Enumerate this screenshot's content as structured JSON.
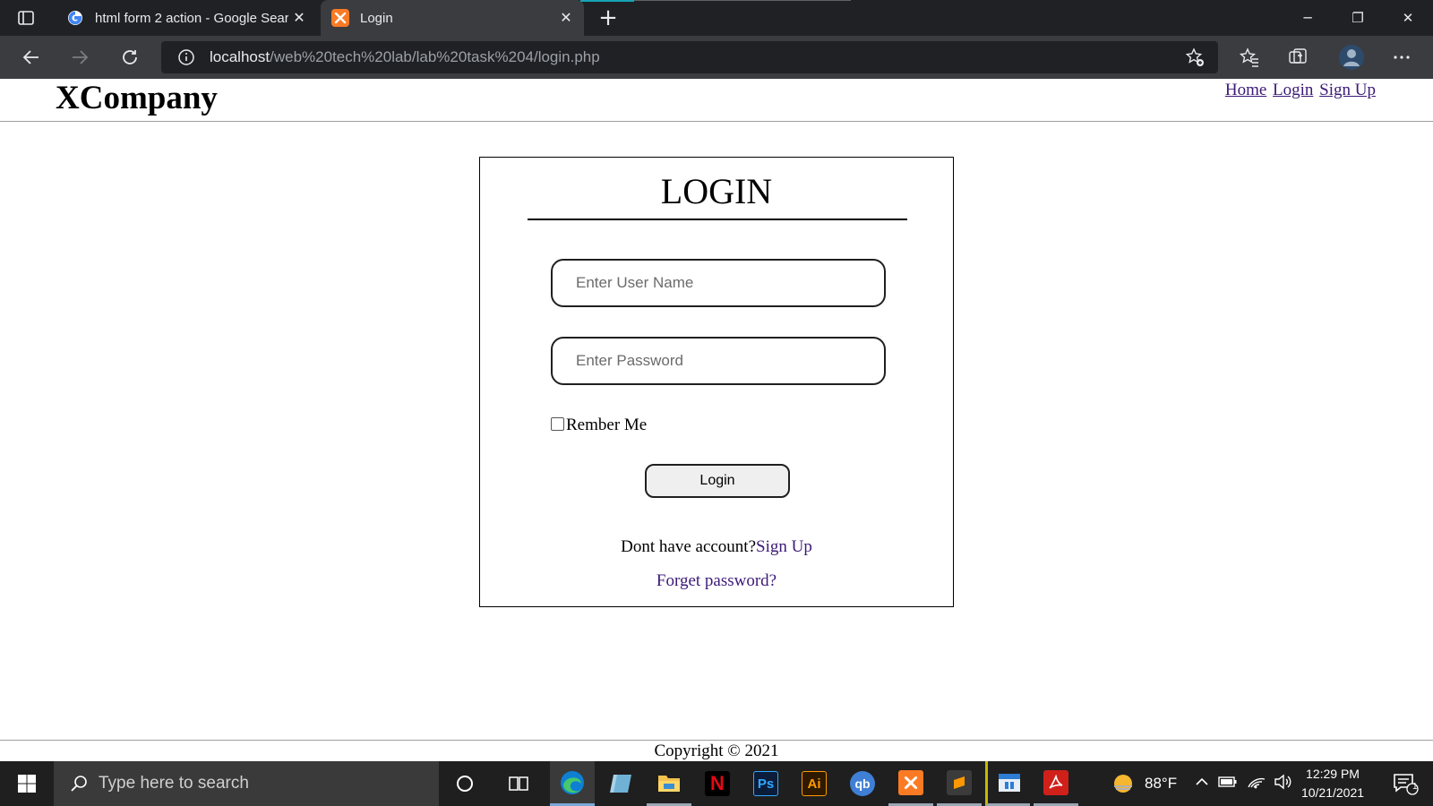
{
  "browser": {
    "tabs": [
      {
        "title": "html form 2 action - Google Sear",
        "favicon": "google-g-icon",
        "active": false
      },
      {
        "title": "Login",
        "favicon": "xampp-icon",
        "active": true
      }
    ],
    "new_tab_glyph": "+",
    "address": {
      "host": "localhost",
      "path": "/web%20tech%20lab/lab%20task%204/login.php"
    },
    "window_controls": {
      "minimize": "─",
      "restore": "❐",
      "close": "✕"
    }
  },
  "page": {
    "brand": "XCompany",
    "nav": [
      {
        "label": "Home"
      },
      {
        "label": "Login"
      },
      {
        "label": "Sign Up"
      }
    ],
    "login": {
      "title": "LOGIN",
      "username_placeholder": "Enter User Name",
      "password_placeholder": "Enter Password",
      "remember_label": "Rember Me",
      "remember_checked": false,
      "submit_label": "Login",
      "no_account_text": "Dont have account?",
      "signup_link": "Sign Up",
      "forgot_link": "Forget password?"
    },
    "footer": "Copyright © 2021"
  },
  "taskbar": {
    "search_placeholder": "Type here to search",
    "apps": [
      {
        "name": "cortana",
        "icon": "cortana-circle-icon"
      },
      {
        "name": "task-view",
        "icon": "task-view-icon"
      },
      {
        "name": "edge",
        "icon": "edge-icon"
      },
      {
        "name": "notes",
        "icon": "notes-icon"
      },
      {
        "name": "file-explorer",
        "icon": "folder-icon"
      },
      {
        "name": "netflix",
        "icon": "netflix-icon",
        "glyph": "N"
      },
      {
        "name": "photoshop",
        "icon": "photoshop-icon",
        "glyph": "Ps"
      },
      {
        "name": "illustrator",
        "icon": "illustrator-icon",
        "glyph": "Ai"
      },
      {
        "name": "qbittorrent",
        "icon": "qbittorrent-icon",
        "glyph": "qb"
      },
      {
        "name": "xampp",
        "icon": "xampp-icon"
      },
      {
        "name": "sublime-text",
        "icon": "sublime-icon"
      },
      {
        "name": "calendar-app",
        "icon": "calendar-app-icon"
      },
      {
        "name": "acrobat",
        "icon": "acrobat-icon"
      }
    ],
    "weather": "88°F",
    "time": "12:29 PM",
    "date": "10/21/2021",
    "notification_count": "1"
  },
  "colors": {
    "link_visited": "#3c1a78",
    "browser_dark": "#202124",
    "toolbar": "#3b3c3f",
    "taskbar": "#1f1f1f"
  }
}
